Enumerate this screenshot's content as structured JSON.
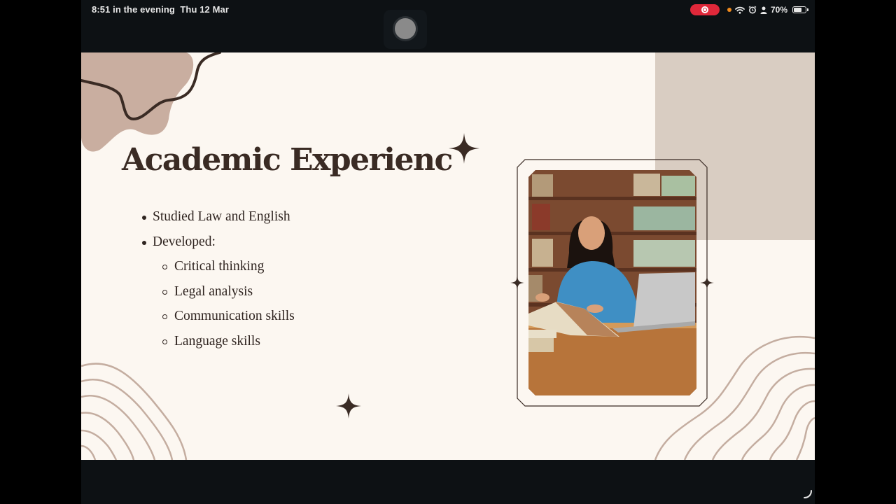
{
  "status_bar": {
    "time": "8:51 in the evening",
    "date": "Thu 12 Mar",
    "battery": "70%",
    "battery_level": 0.7,
    "icons": [
      "screen-record-icon",
      "orange-dot-icon",
      "wifi-icon",
      "alarm-icon",
      "person-icon",
      "battery-icon"
    ]
  },
  "slide": {
    "title": "Academic Experienc",
    "bullets": [
      {
        "text": "Studied Law and English",
        "level": 1
      },
      {
        "text": "Developed:",
        "level": 1
      },
      {
        "text": "Critical thinking",
        "level": 2
      },
      {
        "text": "Legal analysis",
        "level": 2
      },
      {
        "text": "Communication skills",
        "level": 2
      },
      {
        "text": "Language skills",
        "level": 2
      }
    ],
    "image": "student-with-books-photo"
  },
  "colors": {
    "slide_bg": "#fcf7f1",
    "accent_beige": "#d9cdc2",
    "blob": "#c9aea0",
    "dark_brown": "#3a2b24",
    "contour": "#c4ada0"
  }
}
